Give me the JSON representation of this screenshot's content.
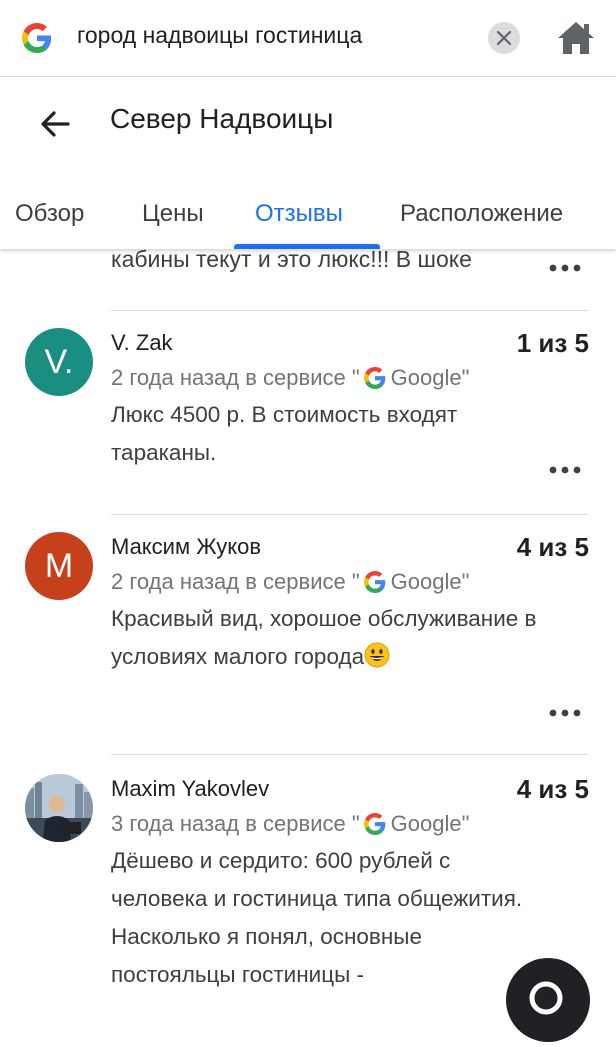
{
  "search": {
    "query": "город надвоицы гостиница",
    "logo_icon": "google-g-icon",
    "clear_icon": "close-icon",
    "home_icon": "home-icon"
  },
  "header": {
    "back_icon": "arrow-back-icon",
    "title": "Север Надвоицы"
  },
  "tabs": [
    {
      "label": "Обзор",
      "active": false
    },
    {
      "label": "Цены",
      "active": false
    },
    {
      "label": "Отзывы",
      "active": true
    },
    {
      "label": "Расположение",
      "active": false
    }
  ],
  "partial_review": {
    "text": "кабины текут и это люкс!!! В шоке"
  },
  "reviews": [
    {
      "author": "V. Zak",
      "avatar_letter": "V.",
      "avatar_color": "#1a8e80",
      "rating": "1 из 5",
      "time": "2 года назад в сервисе \"",
      "source": "Google",
      "source_end": "\"",
      "text": "Люкс 4500 р. В стоимость входят тараканы."
    },
    {
      "author": "Максим Жуков",
      "avatar_letter": "М",
      "avatar_color": "#c5401b",
      "rating": "4 из 5",
      "time": "2 года назад в сервисе \"",
      "source": "Google",
      "source_end": "\"",
      "text": "Красивый вид, хорошое обслуживание в условиях малого города"
    },
    {
      "author": "Maxim Yakovlev",
      "avatar_letter": "",
      "avatar_color": "#6b7f94",
      "rating": "4 из 5",
      "time": "3 года назад в сервисе \"",
      "source": "Google",
      "source_end": "\"",
      "text": "Дёшево и сердито: 600 рублей с человека и гостиница типа общежития. Насколько я понял, основные постояльцы гостиницы -"
    }
  ],
  "colors": {
    "accent": "#1a73e8",
    "divider": "#dadce0",
    "secondary_text": "#70757a"
  }
}
